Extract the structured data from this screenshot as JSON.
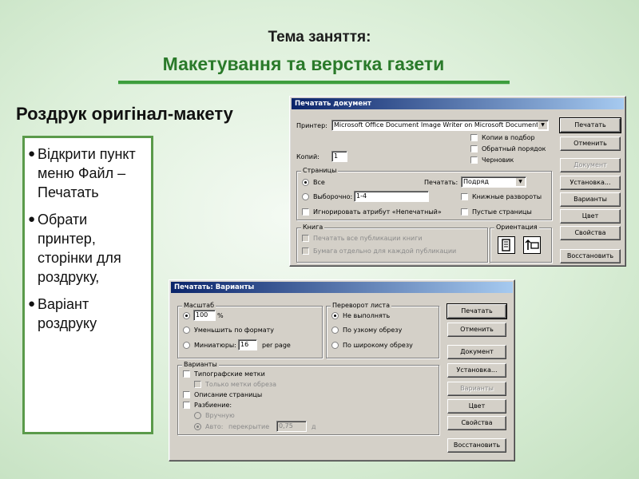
{
  "slide": {
    "topic": "Тема заняття:",
    "title": "Макетування та верстка газети",
    "section_heading": "Роздрук оригінал-макету",
    "bullets": [
      "Відкрити пункт меню Файл – Печатать",
      "Обрати принтер, сторінки для роздруку,",
      "Варіант роздруку"
    ],
    "accent_color": "#2a7a2a"
  },
  "print_dialog": {
    "title": "Печатать документ",
    "printer_label": "Принтер:",
    "printer_value": "Microsoft Office Document Image Writer on Microsoft Document",
    "copies_label": "Копий:",
    "copies_value": "1",
    "collate_label": "Копии в подбор",
    "reverse_label": "Обратный порядок",
    "draft_label": "Черновик",
    "pages_group": "Страницы",
    "all_label": "Все",
    "selection_label": "Выборочно:",
    "selection_value": "1-4",
    "ignore_label": "Игнорировать атрибут «Непечатный»",
    "print_label": "Печатать:",
    "print_value": "Подряд",
    "book_spreads_label": "Книжные развороты",
    "blank_pages_label": "Пустые страницы",
    "book_group": "Книга",
    "book_all_label": "Печатать все публикации книги",
    "book_separate_label": "Бумага отдельно для каждой публикации",
    "orientation_group": "Ориентация",
    "buttons": [
      "Печатать",
      "Отменить",
      "Документ",
      "Установка...",
      "Варианты",
      "Цвет",
      "Свойства",
      "Восстановить"
    ]
  },
  "options_dialog": {
    "title": "Печатать: Варианты",
    "scale_group": "Масштаб",
    "scale_value": "100",
    "percent": "%",
    "reduce_label": "Уменьшить по формату",
    "thumbnails_label": "Миниатюры:",
    "thumbnails_value": "16",
    "per_page": "per page",
    "flip_group": "Переворот листа",
    "no_flip_label": "Не выполнять",
    "short_edge_label": "По узкому обрезу",
    "long_edge_label": "По широкому обрезу",
    "variants_group": "Варианты",
    "printer_marks_label": "Типографские метки",
    "crop_marks_label": "Только метки обреза",
    "page_info_label": "Описание страницы",
    "tiling_label": "Разбиение:",
    "manual_label": "Вручную",
    "auto_label": "Авто:",
    "overlap_label": "перекрытие",
    "overlap_value": "0,75",
    "unit": "д",
    "buttons": [
      "Печатать",
      "Отменить",
      "Документ",
      "Установка...",
      "Варианты",
      "Цвет",
      "Свойства",
      "Восстановить"
    ]
  }
}
